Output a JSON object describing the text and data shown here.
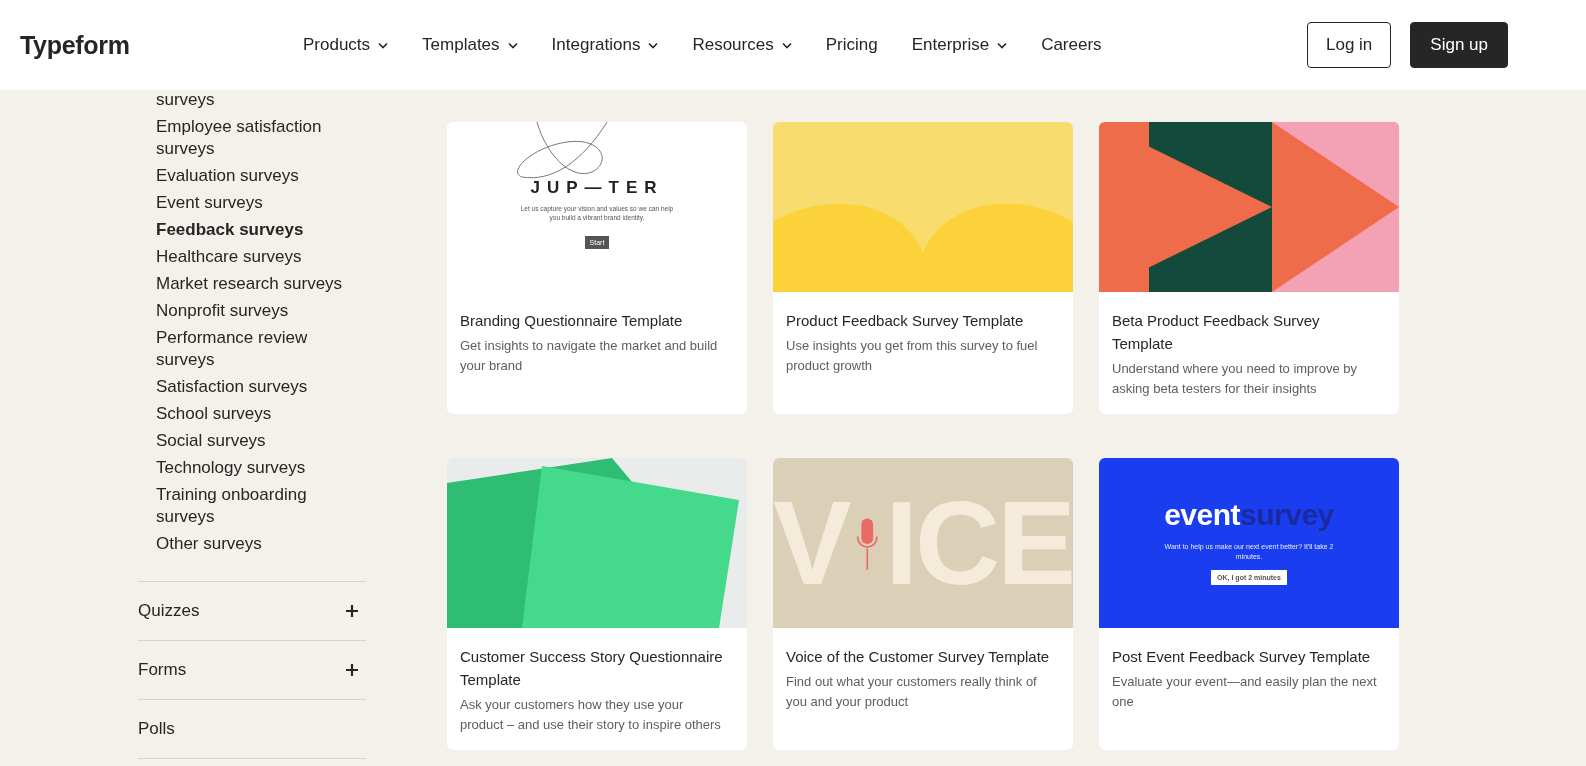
{
  "header": {
    "logo": "Typeform",
    "nav": [
      {
        "label": "Products",
        "has_menu": true
      },
      {
        "label": "Templates",
        "has_menu": true
      },
      {
        "label": "Integrations",
        "has_menu": true
      },
      {
        "label": "Resources",
        "has_menu": true
      },
      {
        "label": "Pricing",
        "has_menu": false
      },
      {
        "label": "Enterprise",
        "has_menu": true
      },
      {
        "label": "Careers",
        "has_menu": false
      }
    ],
    "buttons": [
      {
        "label": "Log in",
        "kind": "outline"
      },
      {
        "label": "Sign up",
        "kind": "filled"
      }
    ]
  },
  "sidebar": {
    "items": [
      {
        "label": "surveys",
        "selected": false
      },
      {
        "label": "Employee satisfaction surveys",
        "selected": false
      },
      {
        "label": "Evaluation surveys",
        "selected": false
      },
      {
        "label": "Event surveys",
        "selected": false
      },
      {
        "label": "Feedback surveys",
        "selected": true
      },
      {
        "label": "Healthcare surveys",
        "selected": false
      },
      {
        "label": "Market research surveys",
        "selected": false
      },
      {
        "label": "Nonprofit surveys",
        "selected": false
      },
      {
        "label": "Performance review surveys",
        "selected": false
      },
      {
        "label": "Satisfaction surveys",
        "selected": false
      },
      {
        "label": "School surveys",
        "selected": false
      },
      {
        "label": "Social surveys",
        "selected": false
      },
      {
        "label": "Technology surveys",
        "selected": false
      },
      {
        "label": "Training onboarding surveys",
        "selected": false
      },
      {
        "label": "Other surveys",
        "selected": false
      }
    ],
    "sections": [
      {
        "label": "Quizzes",
        "expandable": true
      },
      {
        "label": "Forms",
        "expandable": true
      },
      {
        "label": "Polls",
        "expandable": false
      }
    ]
  },
  "cards": [
    {
      "title": "Branding Questionnaire Template",
      "description": "Get insights to navigate the market and build your brand",
      "preview": {
        "kind": "form",
        "heading": "JUP—TER",
        "text": "Let us capture your vision and values so we can help you build a vibrant brand identity.",
        "button": "Start"
      }
    },
    {
      "title": "Product Feedback Survey Template",
      "description": "Use insights you get from this survey to fuel product growth"
    },
    {
      "title": "Beta Product Feedback Survey Template",
      "description": "Understand where you need to improve by asking beta testers for their insights"
    },
    {
      "title": "Customer Success Story Questionnaire Template",
      "description": "Ask your customers how they use your product – and use their story to inspire others"
    },
    {
      "title": "Voice of the Customer Survey Template",
      "description": "Find out what your customers really think of you and your product",
      "preview": {
        "kind": "voice",
        "left": "V",
        "right": "ICE"
      }
    },
    {
      "title": "Post Event Feedback Survey Template",
      "description": "Evaluate your event—and easily plan the next one",
      "preview": {
        "kind": "event",
        "word1": "event",
        "word2": "survey",
        "text": "Want to help us make our next event better? It'll take 2 minutes.",
        "button": "OK, I got 2 minutes"
      }
    }
  ]
}
